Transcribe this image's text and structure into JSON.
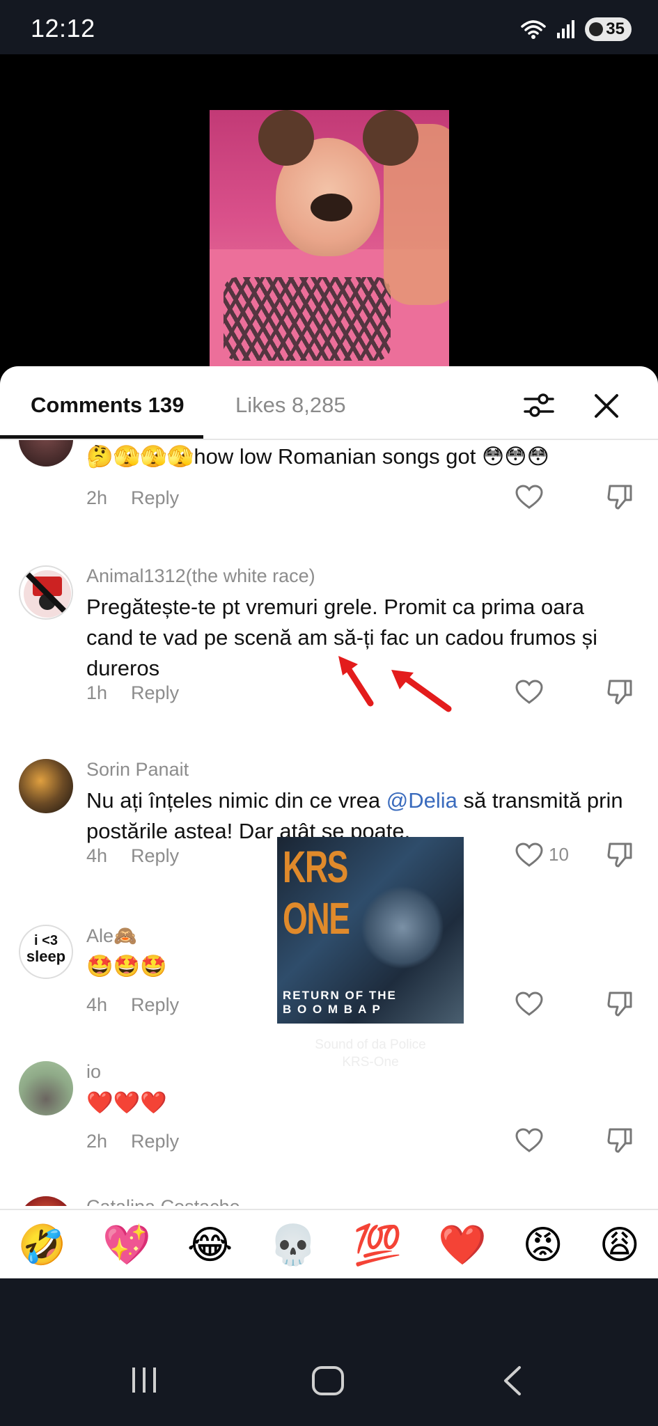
{
  "status_bar": {
    "time": "12:12",
    "battery": "35"
  },
  "header": {
    "comments_tab": "Comments 139",
    "likes_tab": "Likes 8,285"
  },
  "comments": [
    {
      "username": "",
      "text": "🤔🫣🫣🫣how low Romanian songs got 😳😳😳",
      "time": "2h",
      "reply": "Reply",
      "likes": ""
    },
    {
      "username": "Animal1312(the white race)",
      "text": "Pregătește-te pt vremuri grele. Promit ca prima oara cand te vad pe scenă am să-ți fac un cadou frumos și dureros",
      "time": "1h",
      "reply": "Reply",
      "likes": ""
    },
    {
      "username": "Sorin Panait",
      "text_before": "Nu ați înțeles nimic din ce vrea ",
      "mention": "@Delia",
      "text_after": " să transmită prin postările astea! Dar atât se poate.",
      "time": "4h",
      "reply": "Reply",
      "likes": "10"
    },
    {
      "username": "Ale🙈",
      "text": "🤩🤩🤩",
      "time": "4h",
      "reply": "Reply",
      "likes": ""
    },
    {
      "username": "io",
      "text": "❤️❤️❤️",
      "time": "2h",
      "reply": "Reply",
      "likes": ""
    },
    {
      "username": "Catalina Costache",
      "text": "",
      "time": "",
      "reply": "",
      "likes": ""
    }
  ],
  "music": {
    "album_title": "KRS ONE",
    "album_subtitle_1": "RETURN OF THE",
    "album_subtitle_2": "B O O M  B A P",
    "song": "Sound of da Police",
    "artist": "KRS-One"
  },
  "avatar_ale_text_1": "i <3",
  "avatar_ale_text_2": "sleep",
  "emoji_bar": [
    "🤣",
    "💖",
    "😂",
    "💀",
    "💯",
    "❤️",
    "😡",
    "😩"
  ],
  "colors": {
    "accent_mention": "#3a6bbd",
    "arrow": "#e31c1c",
    "sheet_bg": "#ffffff",
    "system_bar": "#141821"
  }
}
